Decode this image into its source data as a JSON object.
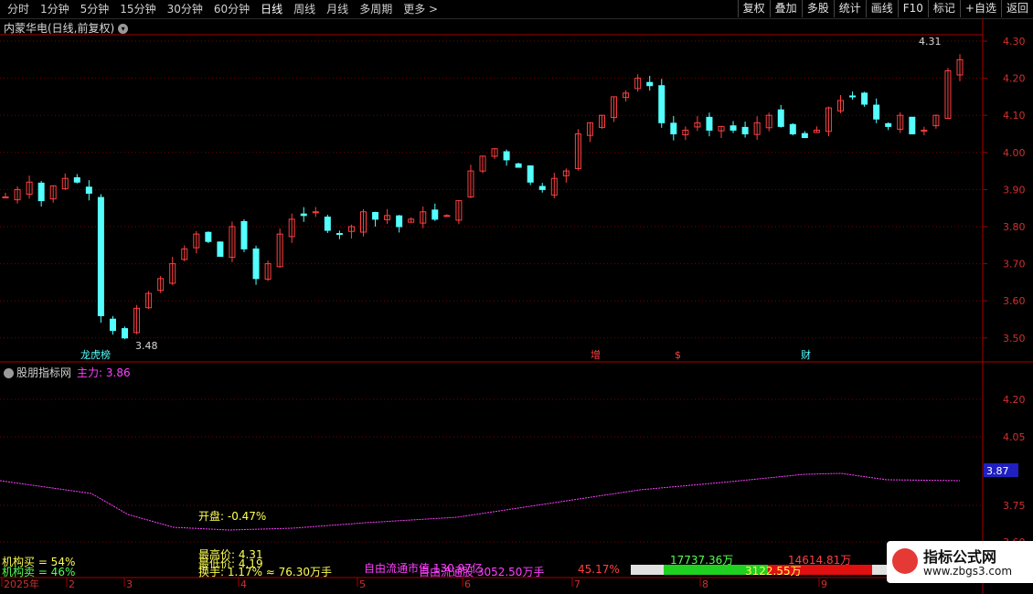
{
  "toolbar": {
    "periods": [
      "分时",
      "1分钟",
      "5分钟",
      "15分钟",
      "30分钟",
      "60分钟",
      "日线",
      "周线",
      "月线",
      "多周期",
      "更多 >"
    ],
    "active_period": "日线",
    "tools": [
      "复权",
      "叠加",
      "多股",
      "统计",
      "画线",
      "F10",
      "标记",
      "+自选",
      "返回"
    ]
  },
  "stock_title": "内蒙华电(日线,前复权)",
  "main_axis": [
    "4.30",
    "4.20",
    "4.10",
    "4.00",
    "3.90",
    "3.80",
    "3.70",
    "3.60",
    "3.50"
  ],
  "price_high_label": "4.31",
  "price_low_label": "3.48",
  "markers": [
    "龙虎榜",
    "增",
    "$",
    "财"
  ],
  "indicator": {
    "name": "股朋指标网",
    "label": "主力: 3.86",
    "axis": [
      "4.20",
      "4.05",
      "3.75",
      "3.60"
    ],
    "current_value": "3.87",
    "open_label": "开盘: -0.47%"
  },
  "info": {
    "inst_buy": "机构买 = 54%",
    "inst_sell": "机构卖 = 46%",
    "high": "最高价: 4.31",
    "low": "最低价: 4.19",
    "turnover": "换手: 1.17% ≈ 76.30万手",
    "float_cap": "自由流通市值 130.97亿",
    "float_shares": "自由流通股 3052.50万手",
    "pct": "45.17%",
    "buy_amt": "17737.36万",
    "sell_amt": "14614.81万",
    "mid_amt": "3122.55万"
  },
  "dates": [
    "2025年",
    "2",
    "3",
    "4",
    "5",
    "6",
    "7",
    "8",
    "9"
  ],
  "watermark": {
    "title": "指标公式网",
    "url": "www.zbgs3.com"
  },
  "colors": {
    "up": "#ff4040",
    "down": "#54ffff",
    "line": "#ff40ff",
    "grid": "#7a0000"
  }
}
